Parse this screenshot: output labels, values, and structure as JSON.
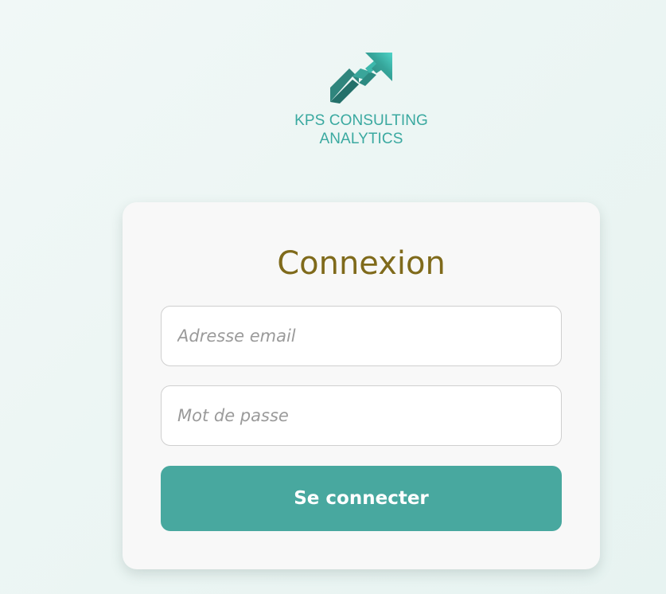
{
  "brand": {
    "line1": "KPS CONSULTING",
    "line2": "ANALYTICS",
    "logo_icon": "trending-up-arrow-icon",
    "color": "#3aa9a0"
  },
  "login": {
    "title": "Connexion",
    "email_placeholder": "Adresse email",
    "email_value": "",
    "password_placeholder": "Mot de passe",
    "password_value": "",
    "submit_label": "Se connecter"
  },
  "colors": {
    "accent": "#48a89f",
    "title": "#7f6a1b",
    "card_background": "#f8f8f8"
  }
}
